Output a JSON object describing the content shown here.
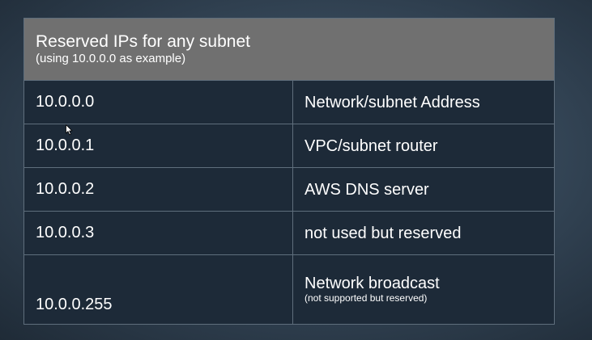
{
  "table": {
    "title": "Reserved IPs for any subnet",
    "subtitle": "(using 10.0.0.0 as example)",
    "rows": [
      {
        "ip": "10.0.0.0",
        "description": "Network/subnet Address",
        "note": ""
      },
      {
        "ip": "10.0.0.1",
        "description": "VPC/subnet router",
        "note": ""
      },
      {
        "ip": "10.0.0.2",
        "description": "AWS DNS server",
        "note": ""
      },
      {
        "ip": "10.0.0.3",
        "description": "not used but reserved",
        "note": ""
      },
      {
        "ip": "10.0.0.255",
        "description": "Network broadcast",
        "note": "(not supported but reserved)"
      }
    ]
  },
  "colors": {
    "header_bg": "#707070",
    "row_bg": "#1d2a38",
    "border": "#5f6e7c",
    "text": "#ffffff"
  },
  "icons": {
    "cursor": "mouse-pointer-icon"
  }
}
